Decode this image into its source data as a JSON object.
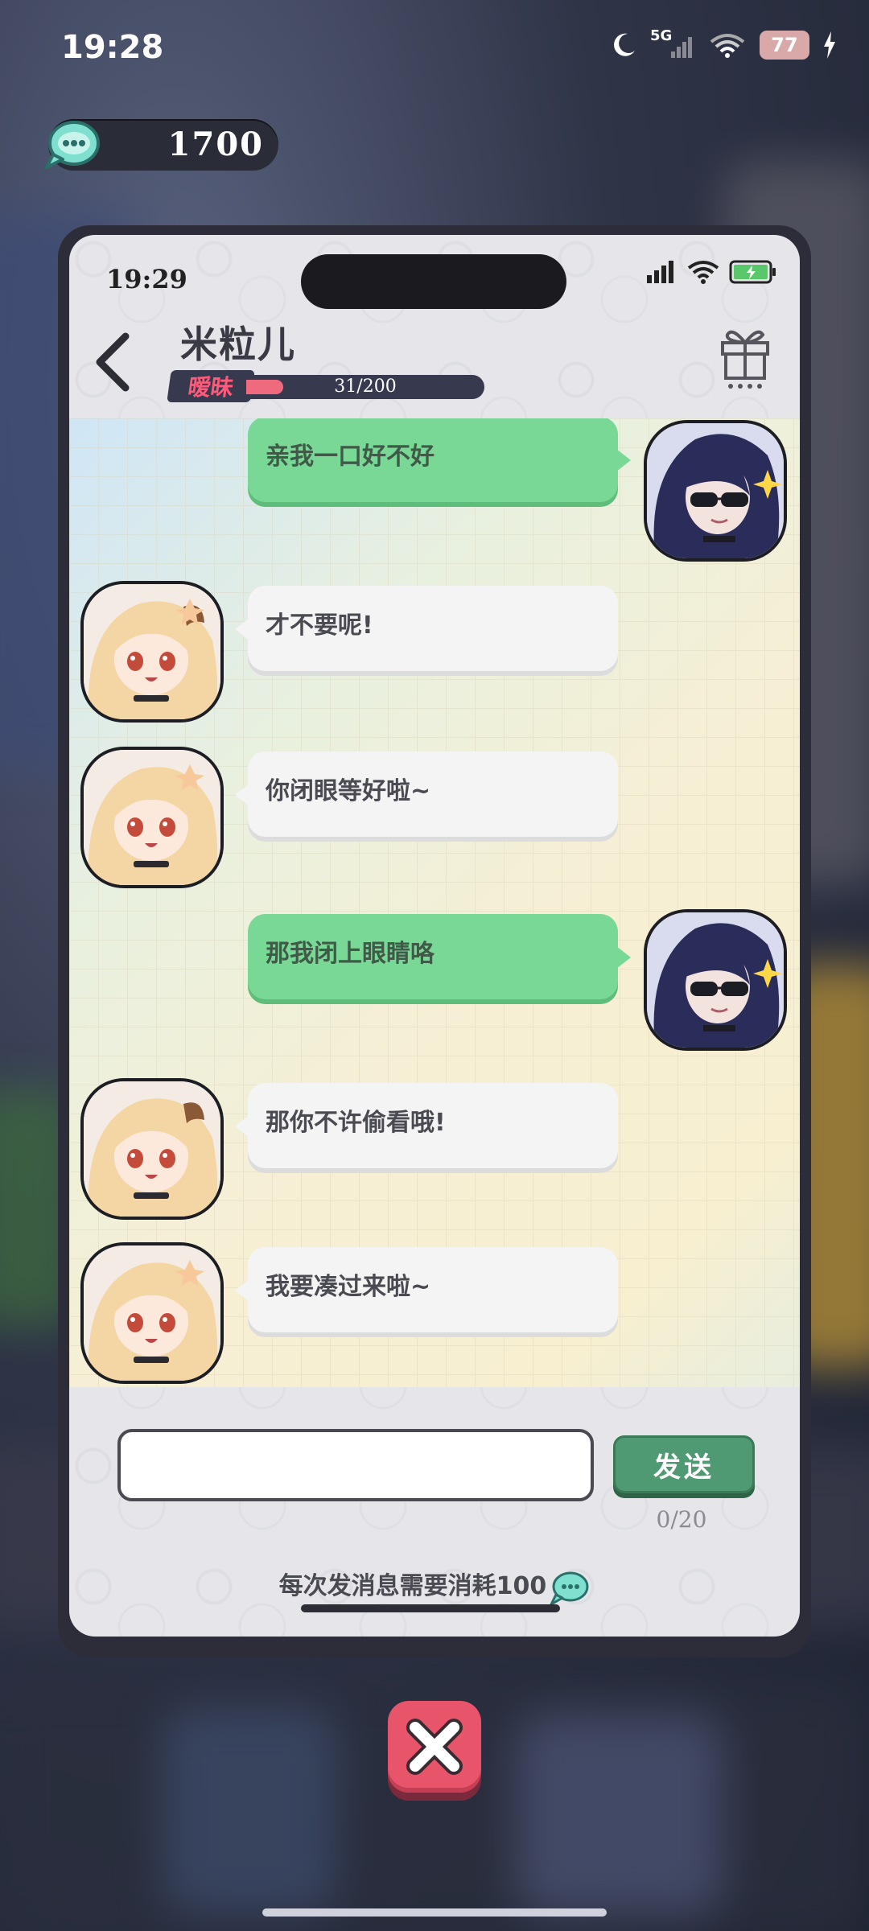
{
  "status_bar": {
    "time": "19:28",
    "network": "5G",
    "battery": "77"
  },
  "currency": {
    "amount": "1700",
    "icon": "chat-bubble-coin-icon"
  },
  "phone": {
    "time": "19:29",
    "contact_name": "米粒儿",
    "relationship": {
      "label": "暧昧",
      "current": 31,
      "max": 200,
      "text": "31/200",
      "fraction": 0.155
    },
    "messages": [
      {
        "side": "right",
        "sender": "player",
        "text": "亲我一口好不好"
      },
      {
        "side": "left",
        "sender": "米粒儿",
        "text": "才不要呢!"
      },
      {
        "side": "left",
        "sender": "米粒儿",
        "text": "你闭眼等好啦~"
      },
      {
        "side": "right",
        "sender": "player",
        "text": "那我闭上眼睛咯"
      },
      {
        "side": "left",
        "sender": "米粒儿",
        "text": "那你不许偷看哦!"
      },
      {
        "side": "left",
        "sender": "米粒儿",
        "text": "我要凑过来啦~"
      }
    ],
    "input": {
      "value": "",
      "placeholder": ""
    },
    "send_label": "发送",
    "char_count": "0/20",
    "cost_note": "每次发消息需要消耗100"
  },
  "colors": {
    "player_bubble": "#7ad896",
    "npc_bubble": "#f4f4f4",
    "send_button": "#4f9a72",
    "close_button": "#e8556a",
    "relationship_fill": "#ef6a7c"
  }
}
